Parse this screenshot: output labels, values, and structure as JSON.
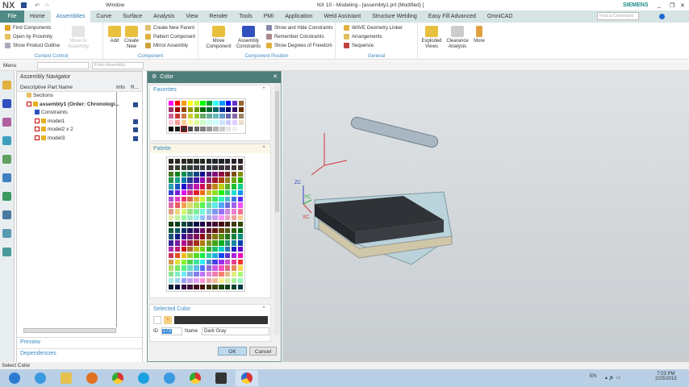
{
  "titlebar": {
    "logo": "NX",
    "window_menu": "Window",
    "title": "NX 10 - Modeling - [assembly1.prt (Modified) ]",
    "brand": "SIEMENS"
  },
  "tabs": [
    "File",
    "Home",
    "Assemblies",
    "Curve",
    "Surface",
    "Analysis",
    "View",
    "Render",
    "Tools",
    "PMI",
    "Application",
    "Weld Assistant",
    "Structure Welding",
    "Easy Fill Advanced",
    "OmniCAD"
  ],
  "search_placeholder": "Find a Command",
  "ribbon": {
    "context_control": {
      "label": "Context Control",
      "items": [
        "Find Components",
        "Open by Proximity",
        "Show Product Outline"
      ],
      "disabled": "Move to Assembly"
    },
    "component": {
      "label": "Component",
      "add": "Add",
      "create_new": "Create New",
      "items": [
        "Create New Parent",
        "Pattern Component",
        "Mirror Assembly"
      ]
    },
    "component_position": {
      "label": "Component Position",
      "move": "Move Component",
      "constraints": "Assembly Constraints",
      "items": [
        "Show and Hide Constraints",
        "Remember Constraints",
        "Show Degrees of Freedom"
      ]
    },
    "general": {
      "label": "General",
      "items": [
        "WAVE Geometry Linker",
        "Arrangements",
        "Sequence"
      ]
    },
    "exploded": "Exploded Views",
    "clearance": "Clearance Analysis",
    "more": "More"
  },
  "toolbar": {
    "menu": "Menu",
    "assembly_placeholder": "Enter Assembly"
  },
  "navigator": {
    "title": "Assembly Navigator",
    "columns": [
      "Descriptive Part Name",
      "Info",
      "R..."
    ],
    "rows": [
      {
        "name": "Sections"
      },
      {
        "name": "assembly1 (Order: Chronologi..."
      },
      {
        "name": "Constraints"
      },
      {
        "name": "model1"
      },
      {
        "name": "model2 x 2"
      },
      {
        "name": "model3"
      }
    ],
    "preview": "Preview",
    "dependencies": "Dependencies"
  },
  "dialog": {
    "title": "Color",
    "favorites": "Favorites",
    "palette": "Palette",
    "selected_color": "Selected Color",
    "id_label": "ID",
    "id_value": "173",
    "name_label": "Name",
    "name_value": "Dark Gray",
    "selected_hex": "#333333",
    "ok": "OK",
    "cancel": "Cancel",
    "favorite_colors": [
      "#ff00ff",
      "#ff0000",
      "#ff9900",
      "#ffff00",
      "#ccff33",
      "#00ff00",
      "#009933",
      "#33ffff",
      "#0099ff",
      "#0000ff",
      "#6633cc",
      "#996633",
      "#993366",
      "#990000",
      "#994400",
      "#999900",
      "#669900",
      "#006600",
      "#006633",
      "#006666",
      "#003399",
      "#000066",
      "#330066",
      "#663300",
      "#cc6699",
      "#cc3333",
      "#cc7744",
      "#cccc33",
      "#99cc33",
      "#66aa66",
      "#66aa99",
      "#66bbbb",
      "#6699cc",
      "#6666aa",
      "#8866aa",
      "#998866",
      "#ffccdd",
      "#ff9999",
      "#ffcc99",
      "#ffff99",
      "#ddff99",
      "#ccffcc",
      "#ccffee",
      "#ccffff",
      "#cce6ff",
      "#ccccff",
      "#ddccff",
      "#eeddcc",
      "#000000",
      "#1a1a1a",
      "#333333",
      "#4d4d4d",
      "#666666",
      "#808080",
      "#999999",
      "#b3b3b3",
      "#cccccc",
      "#e6e6e6",
      "#f2f2f2",
      "#ffffff"
    ]
  },
  "status": "Select Color",
  "tray": {
    "lang": "EN",
    "time": "7:03 PM",
    "date": "2/25/2015"
  },
  "colors": {
    "accent": "#3a8ac0",
    "dialog_title": "#4f7d79",
    "file_tab": "#4e8a86"
  }
}
